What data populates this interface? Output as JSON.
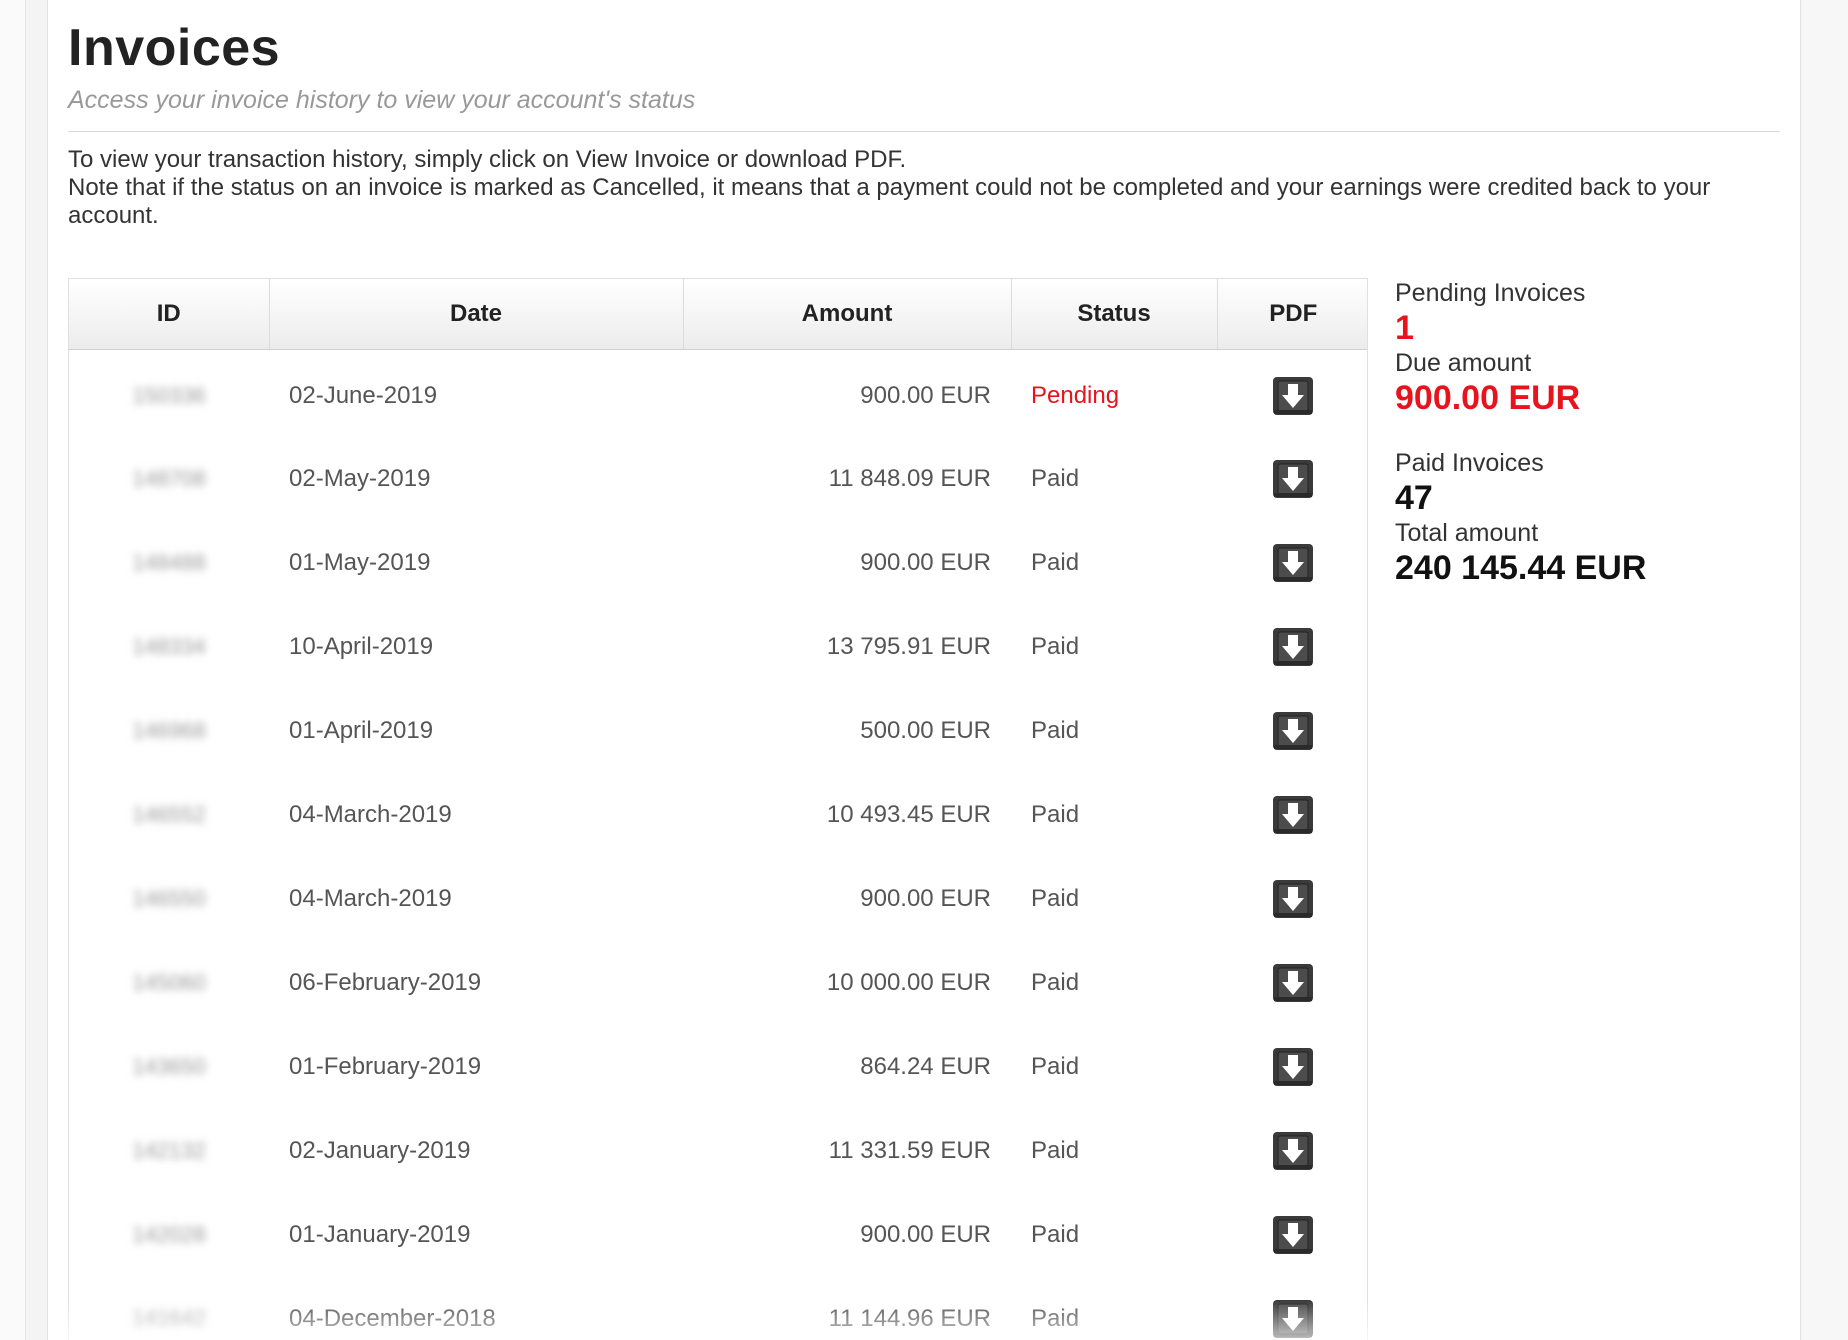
{
  "page": {
    "title": "Invoices",
    "subtitle": "Access your invoice history to view your account's status",
    "intro_line1": "To view your transaction history, simply click on View Invoice or download PDF.",
    "intro_line2": "Note that if the status on an invoice is marked as Cancelled, it means that a payment could not be completed and your earnings were credited back to your account."
  },
  "table": {
    "headers": [
      "ID",
      "Date",
      "Amount",
      "Status",
      "PDF"
    ],
    "rows": [
      {
        "id": "150336",
        "date": "02-June-2019",
        "amount": "900.00 EUR",
        "status": "Pending"
      },
      {
        "id": "148708",
        "date": "02-May-2019",
        "amount": "11 848.09 EUR",
        "status": "Paid"
      },
      {
        "id": "148488",
        "date": "01-May-2019",
        "amount": "900.00 EUR",
        "status": "Paid"
      },
      {
        "id": "148334",
        "date": "10-April-2019",
        "amount": "13 795.91 EUR",
        "status": "Paid"
      },
      {
        "id": "146968",
        "date": "01-April-2019",
        "amount": "500.00 EUR",
        "status": "Paid"
      },
      {
        "id": "146552",
        "date": "04-March-2019",
        "amount": "10 493.45 EUR",
        "status": "Paid"
      },
      {
        "id": "146550",
        "date": "04-March-2019",
        "amount": "900.00 EUR",
        "status": "Paid"
      },
      {
        "id": "145060",
        "date": "06-February-2019",
        "amount": "10 000.00 EUR",
        "status": "Paid"
      },
      {
        "id": "143650",
        "date": "01-February-2019",
        "amount": "864.24 EUR",
        "status": "Paid"
      },
      {
        "id": "142132",
        "date": "02-January-2019",
        "amount": "11 331.59 EUR",
        "status": "Paid"
      },
      {
        "id": "142028",
        "date": "01-January-2019",
        "amount": "900.00 EUR",
        "status": "Paid"
      },
      {
        "id": "141642",
        "date": "04-December-2018",
        "amount": "11 144.96 EUR",
        "status": "Paid"
      }
    ],
    "pdf_icon": "download-pdf-icon"
  },
  "summary": {
    "pending_label": "Pending Invoices",
    "pending_count": "1",
    "due_label": "Due amount",
    "due_amount": "900.00 EUR",
    "paid_label": "Paid Invoices",
    "paid_count": "47",
    "total_label": "Total amount",
    "total_amount": "240 145.44 EUR"
  },
  "colors": {
    "accent_red": "#e8141d",
    "text": "#333333",
    "muted": "#999999"
  }
}
